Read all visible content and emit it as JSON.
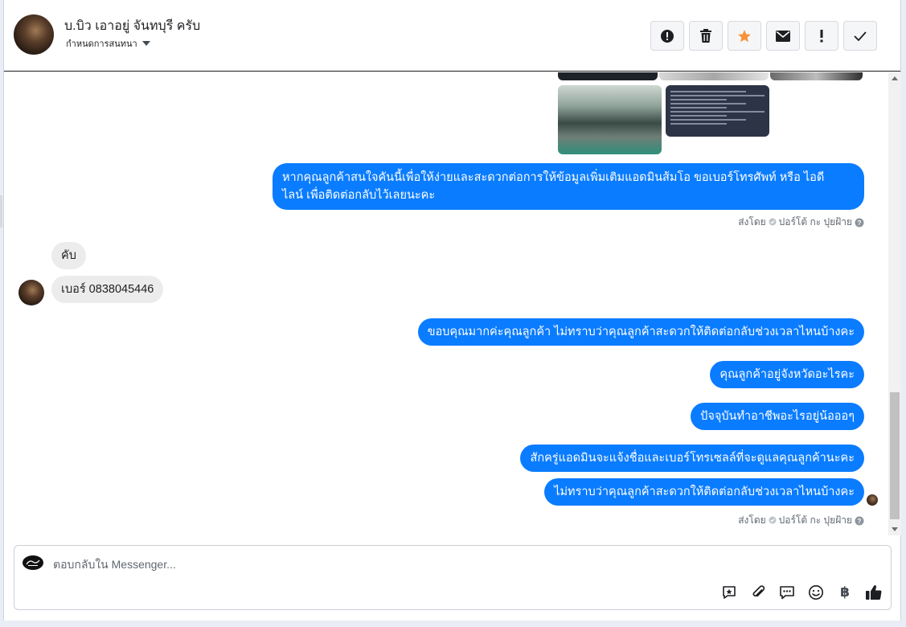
{
  "header": {
    "contact_name": "บ.บิว เอาอยู่ จันทบุรี ครับ",
    "conversation_label": "กำหนดการสนทนา",
    "toolbar": [
      {
        "name": "report-button",
        "icon": "alert-circle-icon"
      },
      {
        "name": "delete-button",
        "icon": "trash-icon"
      },
      {
        "name": "star-button",
        "icon": "star-icon",
        "color": "#f7923b"
      },
      {
        "name": "mark-unread-button",
        "icon": "envelope-icon"
      },
      {
        "name": "spam-button",
        "icon": "exclamation-icon"
      },
      {
        "name": "done-button",
        "icon": "check-icon"
      }
    ]
  },
  "thread": {
    "messages": [
      {
        "id": "m1",
        "direction": "out",
        "text_line1": "หากคุณลูกค้าสนใจคันนี้เพื่อให้ง่ายและสะดวกต่อการให้ข้อมูลเพิ่มเติมแอดมินส้มโอ ขอเบอร์โทรศัพท์ หรือ ไอดี",
        "text_line2": "ไลน์ เพื่อติดต่อกลับไว้เลยนะคะ"
      },
      {
        "id": "m2",
        "direction": "in",
        "text": "คับ"
      },
      {
        "id": "m3",
        "direction": "in",
        "text": "เบอร์ 0838045446"
      },
      {
        "id": "m4",
        "direction": "out",
        "text": "ขอบคุณมากค่ะคุณลูกค้า ไม่ทราบว่าคุณลูกค้าสะดวกให้ติดต่อกลับช่วงเวลาไหนบ้างคะ"
      },
      {
        "id": "m5",
        "direction": "out",
        "text": "คุณลูกค้าอยู่จังหวัดอะไรคะ"
      },
      {
        "id": "m6",
        "direction": "out",
        "text": "ปัจจุบันทำอาชีพอะไรอยู่น้อออๆ"
      },
      {
        "id": "m7",
        "direction": "out",
        "text": "สักครู่แอดมินจะแจ้งชื่อและเบอร์โทรเซลล์ที่จะดูแลคุณลูกค้านะคะ"
      },
      {
        "id": "m8",
        "direction": "out",
        "text": "ไม่ทราบว่าคุณลูกค้าสะดวกให้ติดต่อกลับช่วงเวลาไหนบ้างคะ"
      }
    ],
    "sent_by_1": {
      "prefix": "ส่งโดย",
      "name": "ปอร์โต้ กะ ปุยฝ้าย"
    },
    "sent_by_2": {
      "prefix": "ส่งโดย",
      "name": "ปอร์โต้ กะ ปุยฝ้าย"
    }
  },
  "composer": {
    "placeholder": "ตอบกลับใน Messenger...",
    "tools": [
      "saved-reply-icon",
      "attachment-icon",
      "chat-bubble-icon",
      "emoji-icon",
      "baht-icon",
      "thumbs-up-icon"
    ],
    "baht_symbol": "฿"
  },
  "colors": {
    "outgoing_bubble": "#0a7cff",
    "incoming_bubble": "#ececec",
    "star_accent": "#f7923b"
  }
}
